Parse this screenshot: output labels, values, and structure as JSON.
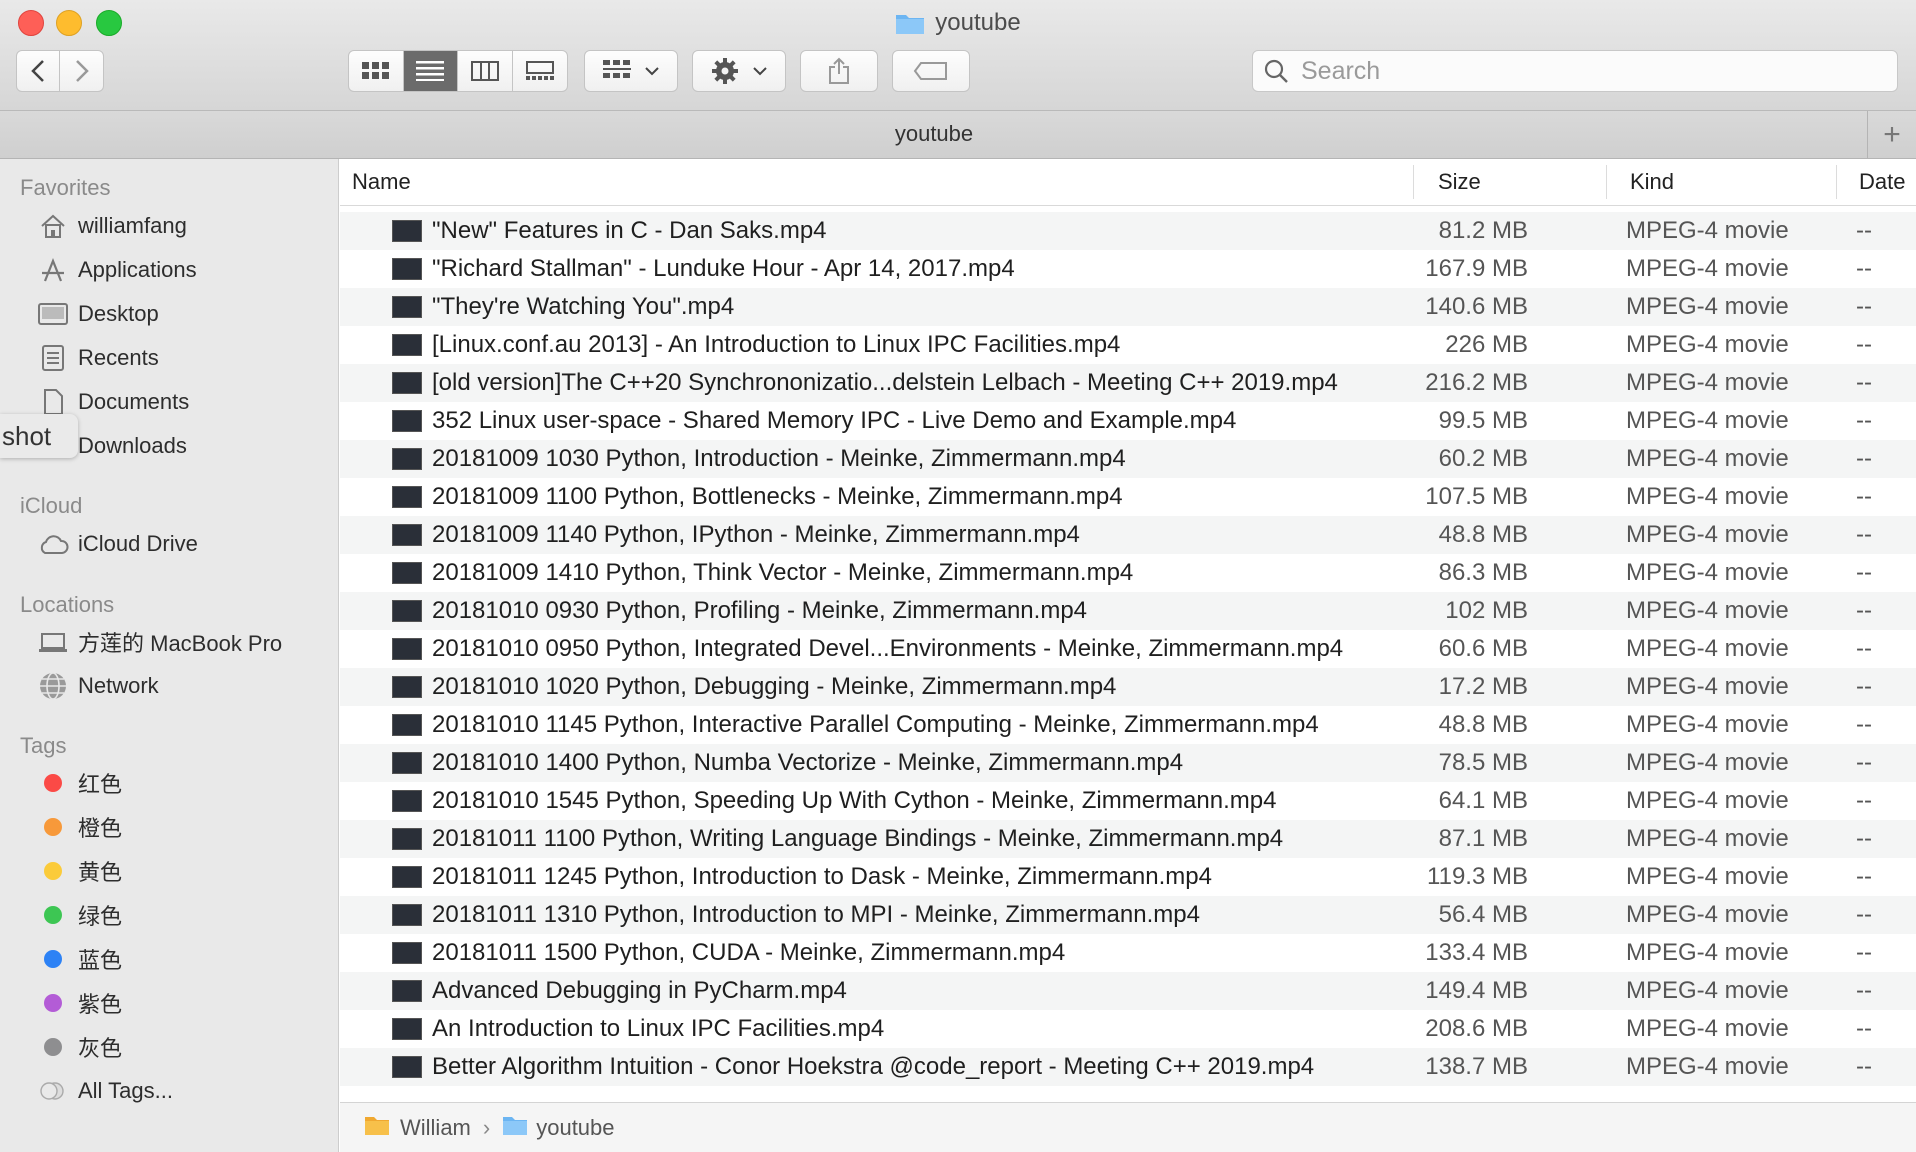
{
  "window": {
    "title": "youtube"
  },
  "toolbar": {
    "search_placeholder": "Search",
    "icons": [
      "back-icon",
      "forward-icon",
      "icon-view-icon",
      "list-view-icon",
      "column-view-icon",
      "gallery-view-icon",
      "group-icon",
      "gear-icon",
      "share-icon",
      "tag-icon",
      "search-icon"
    ]
  },
  "tab": {
    "title": "youtube",
    "add": "+"
  },
  "sidebar": {
    "favorites_header": "Favorites",
    "favorites": [
      {
        "label": "williamfang",
        "icon": "home-icon"
      },
      {
        "label": "Applications",
        "icon": "applications-icon"
      },
      {
        "label": "Desktop",
        "icon": "desktop-icon"
      },
      {
        "label": "Recents",
        "icon": "recents-icon"
      },
      {
        "label": "Documents",
        "icon": "documents-icon"
      },
      {
        "label": "Downloads",
        "icon": "downloads-icon"
      }
    ],
    "icloud_header": "iCloud",
    "icloud": [
      {
        "label": "iCloud Drive",
        "icon": "cloud-icon"
      }
    ],
    "locations_header": "Locations",
    "locations": [
      {
        "label": "方莲的 MacBook Pro",
        "icon": "laptop-icon"
      },
      {
        "label": "Network",
        "icon": "network-icon"
      }
    ],
    "tags_header": "Tags",
    "tags": [
      {
        "label": "红色",
        "color": "#fb4a46"
      },
      {
        "label": "橙色",
        "color": "#f7993a"
      },
      {
        "label": "黄色",
        "color": "#fbcb3a"
      },
      {
        "label": "绿色",
        "color": "#3dc653"
      },
      {
        "label": "蓝色",
        "color": "#2d82f5"
      },
      {
        "label": "紫色",
        "color": "#b35cd6"
      },
      {
        "label": "灰色",
        "color": "#8e8e90"
      },
      {
        "label": "All Tags...",
        "color": ""
      }
    ]
  },
  "tooltip": {
    "text": "shot"
  },
  "columns": {
    "name": "Name",
    "size": "Size",
    "kind": "Kind",
    "date": "Date"
  },
  "files": [
    {
      "name": "\"New\" Features in C - Dan Saks.mp4",
      "size": "81.2 MB",
      "kind": "MPEG-4 movie",
      "date": "--"
    },
    {
      "name": "\"Richard Stallman\" - Lunduke Hour - Apr 14, 2017.mp4",
      "size": "167.9 MB",
      "kind": "MPEG-4 movie",
      "date": "--"
    },
    {
      "name": "\"They're Watching You\".mp4",
      "size": "140.6 MB",
      "kind": "MPEG-4 movie",
      "date": "--"
    },
    {
      "name": "[Linux.conf.au 2013] - An Introduction to Linux IPC Facilities.mp4",
      "size": "226 MB",
      "kind": "MPEG-4 movie",
      "date": "--"
    },
    {
      "name": "[old version]The C++20 Synchrononizatio...delstein Lelbach - Meeting C++ 2019.mp4",
      "size": "216.2 MB",
      "kind": "MPEG-4 movie",
      "date": "--"
    },
    {
      "name": "352 Linux user-space - Shared Memory IPC - Live Demo and Example.mp4",
      "size": "99.5 MB",
      "kind": "MPEG-4 movie",
      "date": "--"
    },
    {
      "name": "20181009 1030 Python, Introduction - Meinke, Zimmermann.mp4",
      "size": "60.2 MB",
      "kind": "MPEG-4 movie",
      "date": "--"
    },
    {
      "name": "20181009 1100 Python, Bottlenecks - Meinke, Zimmermann.mp4",
      "size": "107.5 MB",
      "kind": "MPEG-4 movie",
      "date": "--"
    },
    {
      "name": "20181009 1140 Python, IPython - Meinke, Zimmermann.mp4",
      "size": "48.8 MB",
      "kind": "MPEG-4 movie",
      "date": "--"
    },
    {
      "name": "20181009 1410 Python, Think Vector - Meinke, Zimmermann.mp4",
      "size": "86.3 MB",
      "kind": "MPEG-4 movie",
      "date": "--"
    },
    {
      "name": "20181010 0930 Python, Profiling - Meinke, Zimmermann.mp4",
      "size": "102 MB",
      "kind": "MPEG-4 movie",
      "date": "--"
    },
    {
      "name": "20181010 0950 Python, Integrated Devel...Environments - Meinke, Zimmermann.mp4",
      "size": "60.6 MB",
      "kind": "MPEG-4 movie",
      "date": "--"
    },
    {
      "name": "20181010 1020 Python, Debugging - Meinke, Zimmermann.mp4",
      "size": "17.2 MB",
      "kind": "MPEG-4 movie",
      "date": "--"
    },
    {
      "name": "20181010 1145 Python, Interactive Parallel Computing - Meinke, Zimmermann.mp4",
      "size": "48.8 MB",
      "kind": "MPEG-4 movie",
      "date": "--"
    },
    {
      "name": "20181010 1400 Python, Numba Vectorize - Meinke, Zimmermann.mp4",
      "size": "78.5 MB",
      "kind": "MPEG-4 movie",
      "date": "--"
    },
    {
      "name": "20181010 1545 Python, Speeding Up With Cython - Meinke, Zimmermann.mp4",
      "size": "64.1 MB",
      "kind": "MPEG-4 movie",
      "date": "--"
    },
    {
      "name": "20181011 1100 Python, Writing Language Bindings - Meinke, Zimmermann.mp4",
      "size": "87.1 MB",
      "kind": "MPEG-4 movie",
      "date": "--"
    },
    {
      "name": "20181011 1245 Python, Introduction to Dask - Meinke, Zimmermann.mp4",
      "size": "119.3 MB",
      "kind": "MPEG-4 movie",
      "date": "--"
    },
    {
      "name": "20181011 1310 Python, Introduction to MPI - Meinke, Zimmermann.mp4",
      "size": "56.4 MB",
      "kind": "MPEG-4 movie",
      "date": "--"
    },
    {
      "name": "20181011 1500 Python, CUDA - Meinke, Zimmermann.mp4",
      "size": "133.4 MB",
      "kind": "MPEG-4 movie",
      "date": "--"
    },
    {
      "name": "Advanced Debugging in PyCharm.mp4",
      "size": "149.4 MB",
      "kind": "MPEG-4 movie",
      "date": "--"
    },
    {
      "name": "An Introduction to Linux IPC Facilities.mp4",
      "size": "208.6 MB",
      "kind": "MPEG-4 movie",
      "date": "--"
    },
    {
      "name": "Better Algorithm Intuition - Conor Hoekstra @code_report - Meeting C++ 2019.mp4",
      "size": "138.7 MB",
      "kind": "MPEG-4 movie",
      "date": "--"
    }
  ],
  "pathbar": {
    "items": [
      "William",
      "youtube"
    ],
    "separator": "›"
  }
}
